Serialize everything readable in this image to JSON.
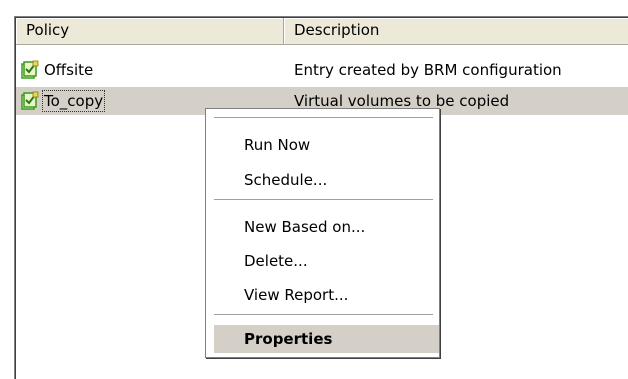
{
  "columns": {
    "policy": "Policy",
    "description": "Description"
  },
  "rows": [
    {
      "policy": "Offsite",
      "description": "Entry created by BRM configuration",
      "icon": "policy-icon"
    },
    {
      "policy": "To_copy",
      "description": "Virtual volumes to be copied",
      "icon": "policy-icon"
    }
  ],
  "context_menu": {
    "items": [
      "Run Now",
      "Schedule...",
      "New Based on...",
      "Delete...",
      "View Report...",
      "Properties"
    ],
    "default_item": "Properties"
  },
  "colors": {
    "header_bg": "#ece9d8",
    "selection_bg": "#d4d0c8",
    "icon_green": "#3a9a1a",
    "icon_yellow": "#e8d84a"
  }
}
